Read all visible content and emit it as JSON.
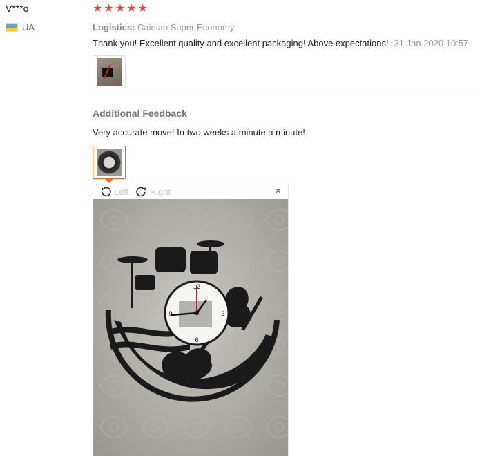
{
  "user": {
    "name": "V***o",
    "country": "UA",
    "flag_colors": [
      "#4fa6e3",
      "#f7d12b"
    ]
  },
  "feedback": {
    "rating": 5,
    "star_color": "#f44336",
    "logistics_label": "Logistics:",
    "logistics_value": "Cainiao Super Economy",
    "text": "Thank you! Excellent quality and excellent packaging! Above expectations!",
    "date": "31 Jan 2020 10:57"
  },
  "additional": {
    "title": "Additional Feedback",
    "text": "Very accurate move! In two weeks a minute a minute!"
  },
  "viewer": {
    "left_label": "Left",
    "right_label": "Right",
    "close_label": "×",
    "accent_color": "#ff6a00"
  }
}
